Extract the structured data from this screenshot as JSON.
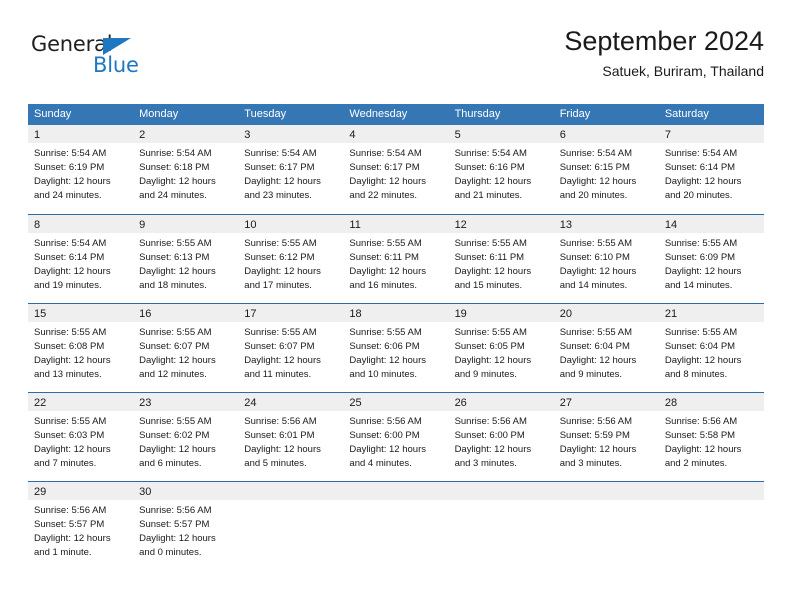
{
  "brand": {
    "name_part1": "General",
    "name_part2": "Blue",
    "triangle_color": "#1f77c2"
  },
  "header": {
    "title": "September 2024",
    "subtitle": "Satuek, Buriram, Thailand"
  },
  "theme": {
    "header_row_bg": "#3576b5",
    "row_divider": "#2d6ca8",
    "day_band_bg": "#efefef",
    "text": "#1a1a1a"
  },
  "weekdays": [
    "Sunday",
    "Monday",
    "Tuesday",
    "Wednesday",
    "Thursday",
    "Friday",
    "Saturday"
  ],
  "weeks": [
    [
      {
        "day": "1",
        "sunrise": "Sunrise: 5:54 AM",
        "sunset": "Sunset: 6:19 PM",
        "daylight1": "Daylight: 12 hours",
        "daylight2": "and 24 minutes."
      },
      {
        "day": "2",
        "sunrise": "Sunrise: 5:54 AM",
        "sunset": "Sunset: 6:18 PM",
        "daylight1": "Daylight: 12 hours",
        "daylight2": "and 24 minutes."
      },
      {
        "day": "3",
        "sunrise": "Sunrise: 5:54 AM",
        "sunset": "Sunset: 6:17 PM",
        "daylight1": "Daylight: 12 hours",
        "daylight2": "and 23 minutes."
      },
      {
        "day": "4",
        "sunrise": "Sunrise: 5:54 AM",
        "sunset": "Sunset: 6:17 PM",
        "daylight1": "Daylight: 12 hours",
        "daylight2": "and 22 minutes."
      },
      {
        "day": "5",
        "sunrise": "Sunrise: 5:54 AM",
        "sunset": "Sunset: 6:16 PM",
        "daylight1": "Daylight: 12 hours",
        "daylight2": "and 21 minutes."
      },
      {
        "day": "6",
        "sunrise": "Sunrise: 5:54 AM",
        "sunset": "Sunset: 6:15 PM",
        "daylight1": "Daylight: 12 hours",
        "daylight2": "and 20 minutes."
      },
      {
        "day": "7",
        "sunrise": "Sunrise: 5:54 AM",
        "sunset": "Sunset: 6:14 PM",
        "daylight1": "Daylight: 12 hours",
        "daylight2": "and 20 minutes."
      }
    ],
    [
      {
        "day": "8",
        "sunrise": "Sunrise: 5:54 AM",
        "sunset": "Sunset: 6:14 PM",
        "daylight1": "Daylight: 12 hours",
        "daylight2": "and 19 minutes."
      },
      {
        "day": "9",
        "sunrise": "Sunrise: 5:55 AM",
        "sunset": "Sunset: 6:13 PM",
        "daylight1": "Daylight: 12 hours",
        "daylight2": "and 18 minutes."
      },
      {
        "day": "10",
        "sunrise": "Sunrise: 5:55 AM",
        "sunset": "Sunset: 6:12 PM",
        "daylight1": "Daylight: 12 hours",
        "daylight2": "and 17 minutes."
      },
      {
        "day": "11",
        "sunrise": "Sunrise: 5:55 AM",
        "sunset": "Sunset: 6:11 PM",
        "daylight1": "Daylight: 12 hours",
        "daylight2": "and 16 minutes."
      },
      {
        "day": "12",
        "sunrise": "Sunrise: 5:55 AM",
        "sunset": "Sunset: 6:11 PM",
        "daylight1": "Daylight: 12 hours",
        "daylight2": "and 15 minutes."
      },
      {
        "day": "13",
        "sunrise": "Sunrise: 5:55 AM",
        "sunset": "Sunset: 6:10 PM",
        "daylight1": "Daylight: 12 hours",
        "daylight2": "and 14 minutes."
      },
      {
        "day": "14",
        "sunrise": "Sunrise: 5:55 AM",
        "sunset": "Sunset: 6:09 PM",
        "daylight1": "Daylight: 12 hours",
        "daylight2": "and 14 minutes."
      }
    ],
    [
      {
        "day": "15",
        "sunrise": "Sunrise: 5:55 AM",
        "sunset": "Sunset: 6:08 PM",
        "daylight1": "Daylight: 12 hours",
        "daylight2": "and 13 minutes."
      },
      {
        "day": "16",
        "sunrise": "Sunrise: 5:55 AM",
        "sunset": "Sunset: 6:07 PM",
        "daylight1": "Daylight: 12 hours",
        "daylight2": "and 12 minutes."
      },
      {
        "day": "17",
        "sunrise": "Sunrise: 5:55 AM",
        "sunset": "Sunset: 6:07 PM",
        "daylight1": "Daylight: 12 hours",
        "daylight2": "and 11 minutes."
      },
      {
        "day": "18",
        "sunrise": "Sunrise: 5:55 AM",
        "sunset": "Sunset: 6:06 PM",
        "daylight1": "Daylight: 12 hours",
        "daylight2": "and 10 minutes."
      },
      {
        "day": "19",
        "sunrise": "Sunrise: 5:55 AM",
        "sunset": "Sunset: 6:05 PM",
        "daylight1": "Daylight: 12 hours",
        "daylight2": "and 9 minutes."
      },
      {
        "day": "20",
        "sunrise": "Sunrise: 5:55 AM",
        "sunset": "Sunset: 6:04 PM",
        "daylight1": "Daylight: 12 hours",
        "daylight2": "and 9 minutes."
      },
      {
        "day": "21",
        "sunrise": "Sunrise: 5:55 AM",
        "sunset": "Sunset: 6:04 PM",
        "daylight1": "Daylight: 12 hours",
        "daylight2": "and 8 minutes."
      }
    ],
    [
      {
        "day": "22",
        "sunrise": "Sunrise: 5:55 AM",
        "sunset": "Sunset: 6:03 PM",
        "daylight1": "Daylight: 12 hours",
        "daylight2": "and 7 minutes."
      },
      {
        "day": "23",
        "sunrise": "Sunrise: 5:55 AM",
        "sunset": "Sunset: 6:02 PM",
        "daylight1": "Daylight: 12 hours",
        "daylight2": "and 6 minutes."
      },
      {
        "day": "24",
        "sunrise": "Sunrise: 5:56 AM",
        "sunset": "Sunset: 6:01 PM",
        "daylight1": "Daylight: 12 hours",
        "daylight2": "and 5 minutes."
      },
      {
        "day": "25",
        "sunrise": "Sunrise: 5:56 AM",
        "sunset": "Sunset: 6:00 PM",
        "daylight1": "Daylight: 12 hours",
        "daylight2": "and 4 minutes."
      },
      {
        "day": "26",
        "sunrise": "Sunrise: 5:56 AM",
        "sunset": "Sunset: 6:00 PM",
        "daylight1": "Daylight: 12 hours",
        "daylight2": "and 3 minutes."
      },
      {
        "day": "27",
        "sunrise": "Sunrise: 5:56 AM",
        "sunset": "Sunset: 5:59 PM",
        "daylight1": "Daylight: 12 hours",
        "daylight2": "and 3 minutes."
      },
      {
        "day": "28",
        "sunrise": "Sunrise: 5:56 AM",
        "sunset": "Sunset: 5:58 PM",
        "daylight1": "Daylight: 12 hours",
        "daylight2": "and 2 minutes."
      }
    ],
    [
      {
        "day": "29",
        "sunrise": "Sunrise: 5:56 AM",
        "sunset": "Sunset: 5:57 PM",
        "daylight1": "Daylight: 12 hours",
        "daylight2": "and 1 minute."
      },
      {
        "day": "30",
        "sunrise": "Sunrise: 5:56 AM",
        "sunset": "Sunset: 5:57 PM",
        "daylight1": "Daylight: 12 hours",
        "daylight2": "and 0 minutes."
      },
      {
        "day": "",
        "sunrise": "",
        "sunset": "",
        "daylight1": "",
        "daylight2": ""
      },
      {
        "day": "",
        "sunrise": "",
        "sunset": "",
        "daylight1": "",
        "daylight2": ""
      },
      {
        "day": "",
        "sunrise": "",
        "sunset": "",
        "daylight1": "",
        "daylight2": ""
      },
      {
        "day": "",
        "sunrise": "",
        "sunset": "",
        "daylight1": "",
        "daylight2": ""
      },
      {
        "day": "",
        "sunrise": "",
        "sunset": "",
        "daylight1": "",
        "daylight2": ""
      }
    ]
  ]
}
